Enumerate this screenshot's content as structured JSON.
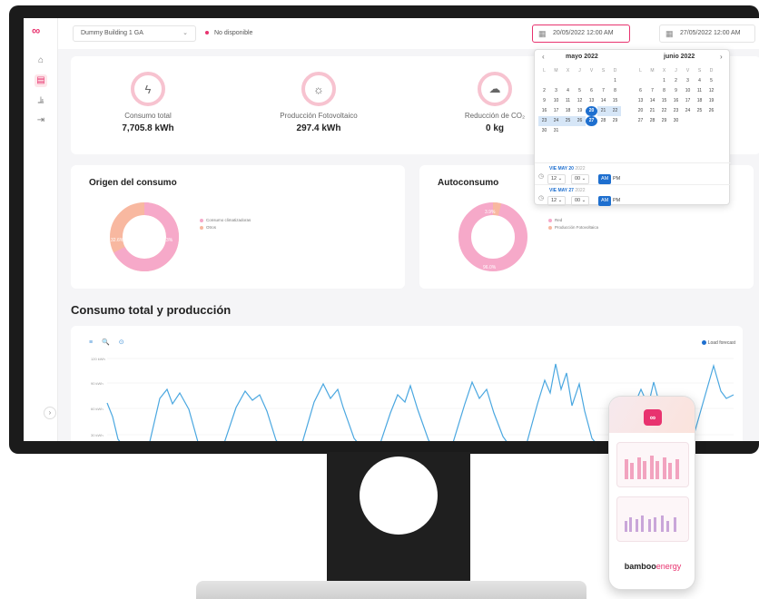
{
  "app": {
    "logo": "∞"
  },
  "sidebar": {
    "items": [
      {
        "icon": "home-icon",
        "glyph": "⌂"
      },
      {
        "icon": "building-icon",
        "glyph": "▤"
      },
      {
        "icon": "chart-icon",
        "glyph": "⫡"
      },
      {
        "icon": "logout-icon",
        "glyph": "⇥"
      }
    ],
    "collapse_glyph": "›"
  },
  "topbar": {
    "building": "Dummy Building 1 GA",
    "building_chevron": "⌄",
    "status": "No disponible",
    "date_from": "20/05/2022 12:00 AM",
    "date_to": "27/05/2022 12:00 AM",
    "arrow": "→"
  },
  "kpis": [
    {
      "label": "Consumo total",
      "value": "7,705.8 kWh",
      "icon": "bolt-icon",
      "glyph": "ϟ"
    },
    {
      "label": "Producción Fotovoltaico",
      "value": "297.4 kWh",
      "icon": "sun-icon",
      "glyph": "☼"
    },
    {
      "label": "Reducción de CO₂",
      "value": "0 kg",
      "icon": "cloud-icon",
      "glyph": "☁"
    }
  ],
  "origen": {
    "title": "Origen del consumo",
    "legend": [
      "Consumo climatizadoras",
      "Otros"
    ],
    "labels": [
      "67.3%",
      "32.6%"
    ],
    "percent": 67.3
  },
  "autoconsumo": {
    "title": "Autoconsumo",
    "legend": [
      "Red",
      "Producción Fotovoltaica"
    ],
    "labels": [
      "3.9%",
      "96.0%"
    ],
    "percent": 3.9
  },
  "section": {
    "title": "Consumo total y producción"
  },
  "line_chart": {
    "tools": "≡ 🔍 ⊙",
    "legend": "Load forecast",
    "yticks": [
      "120 kWh",
      "90 kWh",
      "60 kWh",
      "30 kWh"
    ],
    "color": "#4aa7e0"
  },
  "datepicker": {
    "prev": "‹",
    "next": "›",
    "month1": "mayo 2022",
    "month2": "junio 2022",
    "weekdays": [
      "L",
      "M",
      "X",
      "J",
      "V",
      "S",
      "D"
    ],
    "time1": {
      "day": "VIE",
      "date": "MAY 20",
      "year": "2022",
      "hour": "12",
      "min": "00",
      "am": "AM",
      "pm": "PM"
    },
    "time2": {
      "day": "VIE",
      "date": "MAY 27",
      "year": "2022",
      "hour": "12",
      "min": "00",
      "am": "AM",
      "pm": "PM"
    }
  },
  "phone": {
    "brand1": "bamboo",
    "brand2": "energy",
    "logo": "∞"
  },
  "colors": {
    "accent": "#e8336f",
    "pink": "#f6a9c9",
    "peach": "#f8b8a0",
    "blue": "#1e6fcf"
  }
}
